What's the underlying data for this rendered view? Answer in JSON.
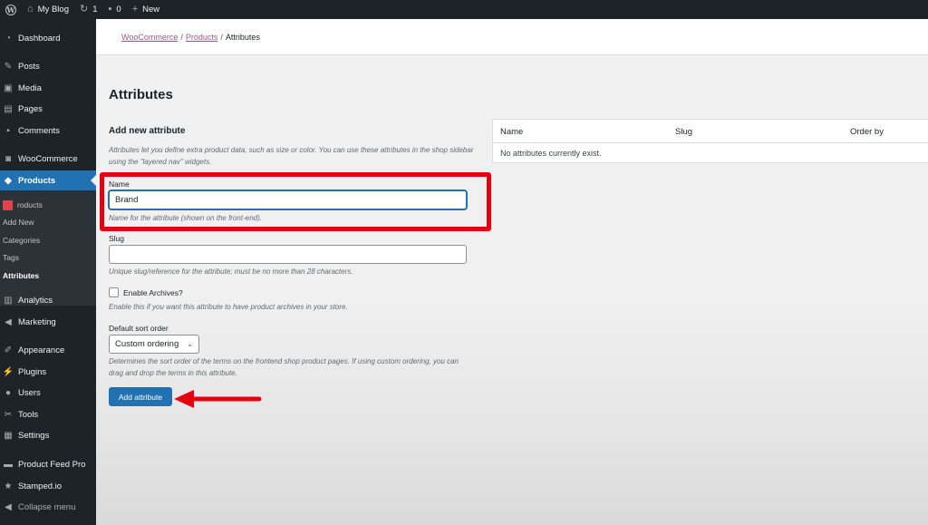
{
  "adminbar": {
    "site_name": "My Blog",
    "updates_count": "1",
    "comments_count": "0",
    "new_label": "New"
  },
  "sidebar": {
    "items": [
      {
        "label": "Dashboard",
        "icon": "dashboard-icon"
      },
      {
        "label": "Posts",
        "icon": "pin-icon"
      },
      {
        "label": "Media",
        "icon": "media-icon"
      },
      {
        "label": "Pages",
        "icon": "pages-icon"
      },
      {
        "label": "Comments",
        "icon": "comments-icon"
      },
      {
        "label": "WooCommerce",
        "icon": "woocommerce-icon"
      },
      {
        "label": "Products",
        "icon": "products-icon"
      },
      {
        "label": "Analytics",
        "icon": "analytics-icon"
      },
      {
        "label": "Marketing",
        "icon": "megaphone-icon"
      },
      {
        "label": "Appearance",
        "icon": "brush-icon"
      },
      {
        "label": "Plugins",
        "icon": "plugin-icon"
      },
      {
        "label": "Users",
        "icon": "users-icon"
      },
      {
        "label": "Tools",
        "icon": "wrench-icon"
      },
      {
        "label": "Settings",
        "icon": "settings-icon"
      },
      {
        "label": "Product Feed Pro",
        "icon": "feed-icon"
      },
      {
        "label": "Stamped.io",
        "icon": "star-icon"
      },
      {
        "label": "Collapse menu",
        "icon": "collapse-icon"
      }
    ],
    "submenu": [
      {
        "label": "roducts"
      },
      {
        "label": "Add New"
      },
      {
        "label": "Categories"
      },
      {
        "label": "Tags"
      },
      {
        "label": "Attributes"
      }
    ]
  },
  "breadcrumb": {
    "woocommerce": "WooCommerce",
    "products": "Products",
    "sep": "/",
    "current": "Attributes"
  },
  "page": {
    "title": "Attributes",
    "section_title": "Add new attribute",
    "intro": "Attributes let you define extra product data, such as size or color. You can use these attributes in the shop sidebar using the \"layered nav\" widgets.",
    "name_label": "Name",
    "name_value": "Brand",
    "name_desc": "Name for the attribute (shown on the front-end).",
    "slug_label": "Slug",
    "slug_value": "",
    "slug_desc": "Unique slug/reference for the attribute; must be no more than 28 characters.",
    "archives_label": "Enable Archives?",
    "archives_desc": "Enable this if you want this attribute to have product archives in your store.",
    "sort_label": "Default sort order",
    "sort_value": "Custom ordering",
    "sort_desc": "Determines the sort order of the terms on the frontend shop product pages. If using custom ordering, you can drag and drop the terms in this attribute.",
    "submit_label": "Add attribute"
  },
  "table": {
    "columns": [
      "Name",
      "Slug",
      "Order by"
    ],
    "empty_message": "No attributes currently exist."
  },
  "colors": {
    "accent": "#2271b1",
    "adminbar": "#1d2327",
    "annotation": "#e3000f",
    "link": "#96588a"
  }
}
